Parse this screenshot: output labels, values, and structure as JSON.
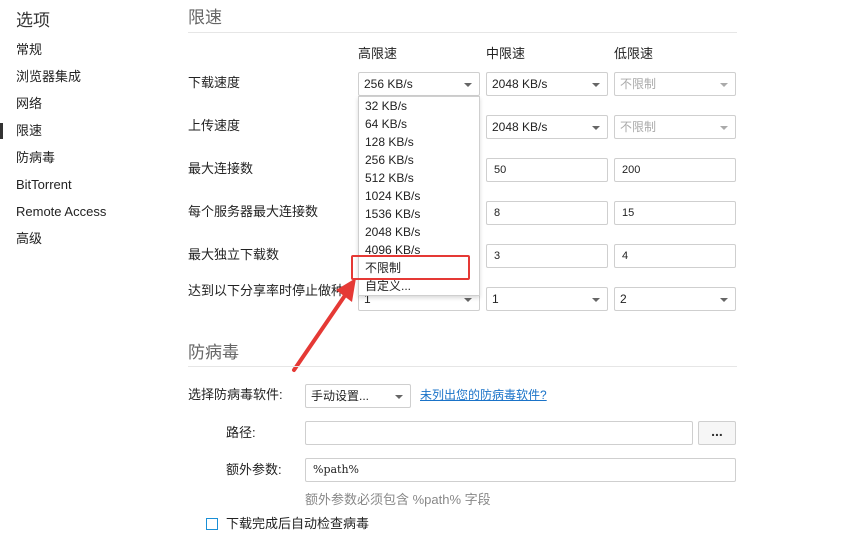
{
  "sidebar": {
    "title": "选项",
    "items": [
      {
        "label": "常规"
      },
      {
        "label": "浏览器集成"
      },
      {
        "label": "网络"
      },
      {
        "label": "限速"
      },
      {
        "label": "防病毒"
      },
      {
        "label": "BitTorrent"
      },
      {
        "label": "Remote Access"
      },
      {
        "label": "高级"
      }
    ],
    "active": "限速"
  },
  "speed": {
    "title": "限速",
    "columns": [
      "高限速",
      "中限速",
      "低限速"
    ],
    "rows": [
      {
        "label": "下载速度",
        "high": "256 KB/s",
        "mid": "2048 KB/s",
        "low": "不限制"
      },
      {
        "label": "上传速度",
        "high": "",
        "mid": "2048 KB/s",
        "low": "不限制"
      },
      {
        "label": "最大连接数",
        "high": "",
        "mid": "50",
        "low": "200"
      },
      {
        "label": "每个服务器最大连接数",
        "high": "",
        "mid": "8",
        "low": "15"
      },
      {
        "label": "最大独立下载数",
        "high": "",
        "mid": "3",
        "low": "4"
      },
      {
        "label": "达到以下分享率时停止做种",
        "high": "1",
        "mid": "1",
        "low": "2"
      }
    ]
  },
  "dropdown": {
    "options": [
      "32 KB/s",
      "64 KB/s",
      "128 KB/s",
      "256 KB/s",
      "512 KB/s",
      "1024 KB/s",
      "1536 KB/s",
      "2048 KB/s",
      "4096 KB/s",
      "不限制",
      "自定义..."
    ],
    "highlighted": "不限制"
  },
  "antivirus": {
    "title": "防病毒",
    "select_label": "选择防病毒软件:",
    "select_value": "手动设置...",
    "link": "未列出您的防病毒软件?",
    "path_label": "路径:",
    "path_value": "",
    "browse_label": "...",
    "args_label": "额外参数:",
    "args_value": "%path%",
    "hint": "额外参数必须包含 %path% 字段",
    "checkbox_label": "下载完成后自动检查病毒"
  },
  "colors": {
    "highlight_box": "#e53935",
    "arrow": "#e53935",
    "link": "#1a73c8",
    "checkbox": "#1a8fd6"
  }
}
